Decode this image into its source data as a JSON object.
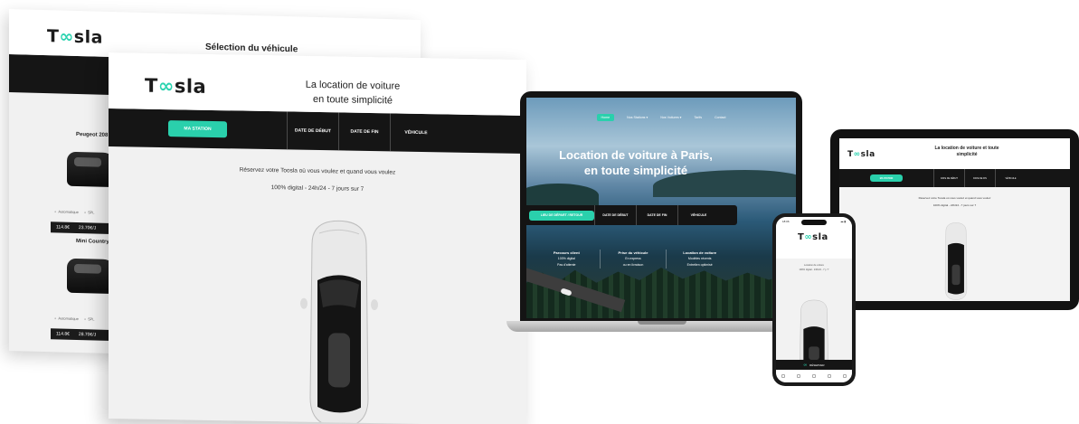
{
  "brand": {
    "logo": "Toosla",
    "accent": "#2ad0ac",
    "dark": "#151515"
  },
  "back_screen": {
    "title": "Sélection du véhicule",
    "vehicles": [
      {
        "name": "Peugeot 208 G",
        "opt1": "Automatique",
        "opt2": "5PL",
        "km": "114.8€",
        "price": "23.70€/J"
      },
      {
        "name": "Mini Countryman H",
        "opt1": "Automatique",
        "opt2": "5PL",
        "km": "114.8€",
        "price": "28.70€/J"
      }
    ]
  },
  "front_screen": {
    "title_line1": "La location de voiture",
    "title_line2": "en toute simplicité",
    "station_button": "MA STATION",
    "segments": [
      "DATE DE DÉBUT",
      "DATE DE FIN",
      "VÉHICULE"
    ],
    "tagline1": "Réservez votre Toosla où vous voulez et quand vous voulez",
    "tagline2": "100% digital - 24h/24 - 7 jours sur 7"
  },
  "laptop": {
    "nav": [
      "Home",
      "Nos Stations ▾",
      "Nos Voitures ▾",
      "Tarifs",
      "Contact"
    ],
    "hero_line1": "Location de voiture à Paris,",
    "hero_line2": "en toute simplicité",
    "search_button": "LIEU DE DÉPART / RETOUR",
    "segments": [
      "DATE DE DÉBUT",
      "DATE DE FIN",
      "VÉHICULE"
    ],
    "columns": [
      {
        "head": "Parcours client",
        "l1": "100% digital",
        "l2": "Pas d'attente"
      },
      {
        "head": "Prise du véhicule",
        "l1": "En express",
        "l2": "ou en livraison"
      },
      {
        "head": "Location de voiture",
        "l1": "Modèles récents",
        "l2": "Entretien optimisé"
      }
    ]
  },
  "tablet": {
    "title_line1": "La location de voiture et toute",
    "title_line2": "simplicité",
    "station_button": "MA STATION",
    "segments": [
      "DATE DE DÉBUT",
      "DATE DE FIN",
      "VÉHICULE"
    ],
    "tagline1": "Réservez votre Toosla où vous voulez et quand vous voulez",
    "tagline2": "100% digital - 24h/24 - 7 jours sur 7"
  },
  "phone": {
    "time": "18:06",
    "signal": "▴▴ ▮",
    "tagline1": "Location de voiture",
    "tagline2": "100% digital - 24h/24 - 7 j / 7",
    "bar_label": "RÉSERVER"
  }
}
